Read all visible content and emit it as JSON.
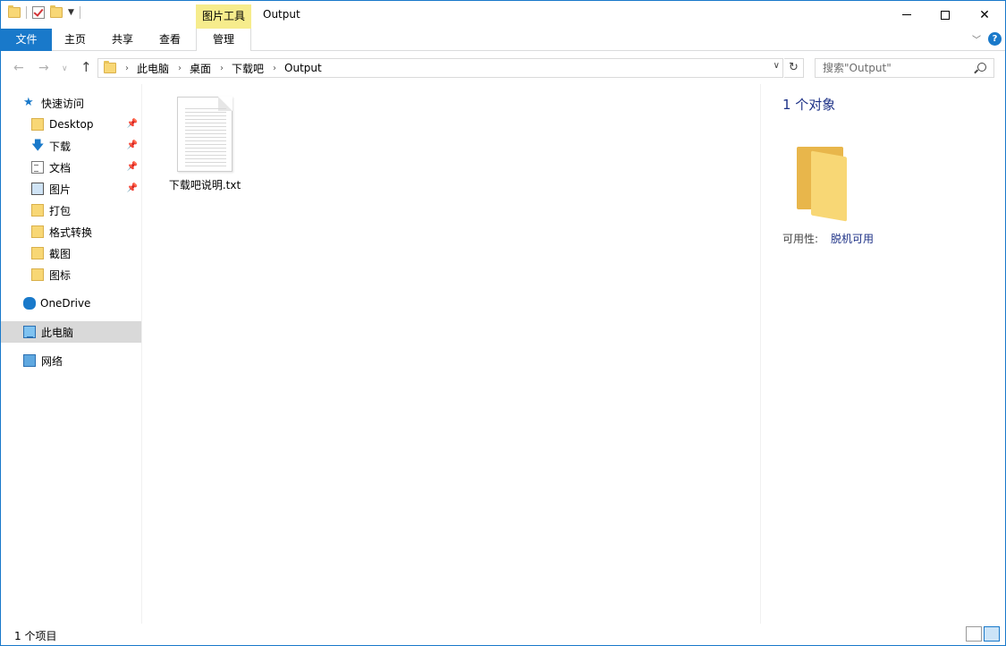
{
  "titlebar": {
    "context_tab": "图片工具",
    "window_title": "Output",
    "minimize_icon": "minimize-icon",
    "maximize_icon": "maximize-icon",
    "close_icon": "close-icon"
  },
  "ribbon": {
    "tabs": {
      "file": "文件",
      "home": "主页",
      "share": "共享",
      "view": "查看",
      "manage": "管理"
    },
    "help_glyph": "?"
  },
  "address": {
    "breadcrumbs": [
      "此电脑",
      "桌面",
      "下载吧",
      "Output"
    ],
    "search_placeholder": "搜索\"Output\""
  },
  "sidebar": {
    "quick_access": "快速访问",
    "items": [
      {
        "label": "Desktop",
        "icon": "folder-icon",
        "pinned": true
      },
      {
        "label": "下载",
        "icon": "download-arrow-icon",
        "pinned": true
      },
      {
        "label": "文档",
        "icon": "document-icon",
        "pinned": true
      },
      {
        "label": "图片",
        "icon": "pictures-icon",
        "pinned": true
      },
      {
        "label": "打包",
        "icon": "folder-icon",
        "pinned": false
      },
      {
        "label": "格式转换",
        "icon": "folder-icon",
        "pinned": false
      },
      {
        "label": "截图",
        "icon": "folder-icon",
        "pinned": false
      },
      {
        "label": "图标",
        "icon": "folder-icon",
        "pinned": false
      }
    ],
    "onedrive": "OneDrive",
    "this_pc": "此电脑",
    "network": "网络"
  },
  "main": {
    "files": [
      {
        "name": "下载吧说明.txt",
        "icon": "text-file-icon"
      }
    ]
  },
  "details": {
    "count": "1 个对象",
    "availability_label": "可用性:",
    "availability_value": "脱机可用"
  },
  "status": {
    "item_count": "1 个项目"
  },
  "colors": {
    "accent": "#1979ca",
    "context_tab": "#f6ec8c",
    "selected_nav": "#d9d9d9",
    "details_title": "#1e3287"
  }
}
